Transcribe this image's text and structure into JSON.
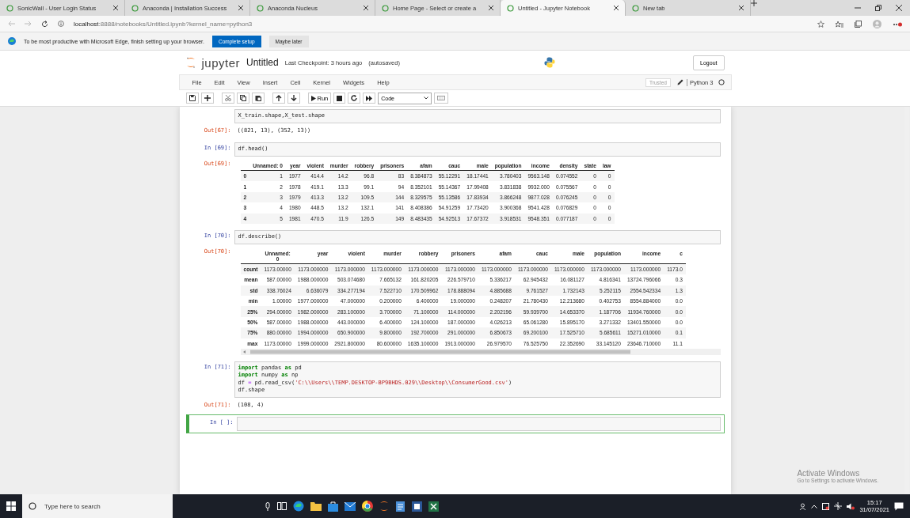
{
  "browser": {
    "tabs": [
      {
        "title": "SonicWall - User Login Status",
        "selected": false
      },
      {
        "title": "Anaconda | Installation Success",
        "selected": false
      },
      {
        "title": "Anaconda Nucleus",
        "selected": false
      },
      {
        "title": "Home Page - Select or create a",
        "selected": false
      },
      {
        "title": "Untitled - Jupyter Notebook",
        "selected": true
      },
      {
        "title": "New tab",
        "selected": false
      }
    ],
    "address": {
      "host": "localhost",
      "rest": ":8888/notebooks/Untitled.ipynb?kernel_name=python3"
    },
    "banner": {
      "text": "To be most productive with Microsoft Edge, finish setting up your browser.",
      "primary": "Complete setup",
      "secondary": "Maybe later"
    }
  },
  "jupyter": {
    "logo": "jupyter",
    "name": "Untitled",
    "checkpoint": "Last Checkpoint: 3 hours ago",
    "autosaved": "(autosaved)",
    "logout": "Logout",
    "menu": [
      "File",
      "Edit",
      "View",
      "Insert",
      "Cell",
      "Kernel",
      "Widgets",
      "Help"
    ],
    "trusted": "Trusted",
    "kernel": "Python 3",
    "run": "Run",
    "cell_type": "Code"
  },
  "cells": [
    {
      "selected": false,
      "lines": [
        "X_train.shape,X_test.shape"
      ],
      "output": {
        "prompt": "Out[67]:",
        "kind": "text",
        "text": "((821, 13), (352, 13))"
      }
    },
    {
      "selected": false,
      "prompt": "In [69]:",
      "lines": [
        "df.head()"
      ],
      "output": {
        "prompt": "Out[69]:",
        "kind": "table",
        "columns": [
          "Unnamed: 0",
          "year",
          "violent",
          "murder",
          "robbery",
          "prisoners",
          "afam",
          "cauc",
          "male",
          "population",
          "income",
          "density",
          "state",
          "law"
        ],
        "rows": [
          {
            "index": "0",
            "cells": [
              "1",
              "1977",
              "414.4",
              "14.2",
              "96.8",
              "83",
              "8.384873",
              "55.12291",
              "18.17441",
              "3.780403",
              "9563.148",
              "0.074552",
              "0",
              "0"
            ]
          },
          {
            "index": "1",
            "cells": [
              "2",
              "1978",
              "419.1",
              "13.3",
              "99.1",
              "94",
              "8.352101",
              "55.14367",
              "17.99408",
              "3.831838",
              "9932.000",
              "0.075567",
              "0",
              "0"
            ]
          },
          {
            "index": "2",
            "cells": [
              "3",
              "1979",
              "413.3",
              "13.2",
              "109.5",
              "144",
              "8.329575",
              "55.13586",
              "17.83934",
              "3.866248",
              "9877.028",
              "0.076245",
              "0",
              "0"
            ]
          },
          {
            "index": "3",
            "cells": [
              "4",
              "1980",
              "448.5",
              "13.2",
              "132.1",
              "141",
              "8.408386",
              "54.91259",
              "17.73420",
              "3.900368",
              "9541.428",
              "0.076829",
              "0",
              "0"
            ]
          },
          {
            "index": "4",
            "cells": [
              "5",
              "1981",
              "470.5",
              "11.9",
              "126.5",
              "149",
              "8.483435",
              "54.92513",
              "17.67372",
              "3.918531",
              "9548.351",
              "0.077187",
              "0",
              "0"
            ]
          }
        ]
      }
    },
    {
      "selected": false,
      "prompt": "In [70]:",
      "lines": [
        "df.describe()"
      ],
      "output": {
        "prompt": "Out[70]:",
        "kind": "wide_table",
        "columns": [
          "Unnamed: 0",
          "year",
          "violent",
          "murder",
          "robbery",
          "prisoners",
          "afam",
          "cauc",
          "male",
          "population",
          "income",
          "c"
        ],
        "rows": [
          {
            "index": "count",
            "cells": [
              "1173.00000",
              "1173.000000",
              "1173.000000",
              "1173.000000",
              "1173.000000",
              "1173.000000",
              "1173.000000",
              "1173.000000",
              "1173.000000",
              "1173.000000",
              "1173.000000",
              "1173.0"
            ]
          },
          {
            "index": "mean",
            "cells": [
              "587.00000",
              "1988.000000",
              "503.074680",
              "7.665132",
              "161.820205",
              "226.579710",
              "5.336217",
              "62.945432",
              "16.081127",
              "4.816341",
              "13724.796066",
              "0.3"
            ]
          },
          {
            "index": "std",
            "cells": [
              "338.76024",
              "6.636079",
              "334.277194",
              "7.522710",
              "170.509962",
              "178.888094",
              "4.885688",
              "9.761527",
              "1.732143",
              "5.252115",
              "2554.542334",
              "1.3"
            ]
          },
          {
            "index": "min",
            "cells": [
              "1.00000",
              "1977.000000",
              "47.000000",
              "0.200000",
              "6.400000",
              "19.000000",
              "0.248207",
              "21.780430",
              "12.213680",
              "0.402753",
              "8554.884000",
              "0.0"
            ]
          },
          {
            "index": "25%",
            "cells": [
              "294.00000",
              "1982.000000",
              "283.100000",
              "3.700000",
              "71.100000",
              "114.000000",
              "2.202196",
              "59.939700",
              "14.653370",
              "1.187706",
              "11934.760000",
              "0.0"
            ]
          },
          {
            "index": "50%",
            "cells": [
              "587.00000",
              "1988.000000",
              "443.000000",
              "6.400000",
              "124.100000",
              "187.000000",
              "4.026213",
              "65.061280",
              "15.895170",
              "3.271332",
              "13401.550000",
              "0.0"
            ]
          },
          {
            "index": "75%",
            "cells": [
              "880.00000",
              "1994.000000",
              "650.900000",
              "9.800000",
              "192.700000",
              "291.000000",
              "6.850673",
              "69.200100",
              "17.525710",
              "5.685611",
              "15271.010000",
              "0.1"
            ]
          },
          {
            "index": "max",
            "cells": [
              "1173.00000",
              "1999.000000",
              "2921.800000",
              "80.600000",
              "1635.100000",
              "1913.000000",
              "26.979570",
              "76.525750",
              "22.352690",
              "33.145120",
              "23646.710000",
              "11.1"
            ]
          }
        ]
      }
    },
    {
      "selected": false,
      "prompt": "In [71]:",
      "lines": [
        [
          {
            "text": "import",
            "kind": "keyword"
          },
          {
            "text": " pandas ",
            "kind": "plain"
          },
          {
            "text": "as",
            "kind": "keyword"
          },
          {
            "text": " pd",
            "kind": "plain"
          }
        ],
        [
          {
            "text": "import",
            "kind": "keyword"
          },
          {
            "text": " numpy ",
            "kind": "plain"
          },
          {
            "text": "as",
            "kind": "keyword"
          },
          {
            "text": " np",
            "kind": "plain"
          }
        ],
        [
          {
            "text": "df ",
            "kind": "plain"
          },
          {
            "text": "=",
            "kind": "operator"
          },
          {
            "text": " pd.read_csv(",
            "kind": "plain"
          },
          {
            "text": "'C:\\\\Users\\\\TEMP.DESKTOP-BP9BHDS.029\\\\Desktop\\\\ConsumerGood.csv'",
            "kind": "string"
          },
          {
            "text": ")",
            "kind": "plain"
          }
        ],
        "df.shape"
      ],
      "output": {
        "prompt": "Out[71]:",
        "kind": "text",
        "text": "(108, 4)"
      }
    },
    {
      "selected": true,
      "prompt": "In [ ]:"
    }
  ],
  "activation": {
    "title": "Activate Windows",
    "hint": "Go to Settings to activate Windows."
  },
  "taskbar": {
    "search_placeholder": "Type here to search",
    "time": "15:17",
    "date": "31/07/2021"
  }
}
